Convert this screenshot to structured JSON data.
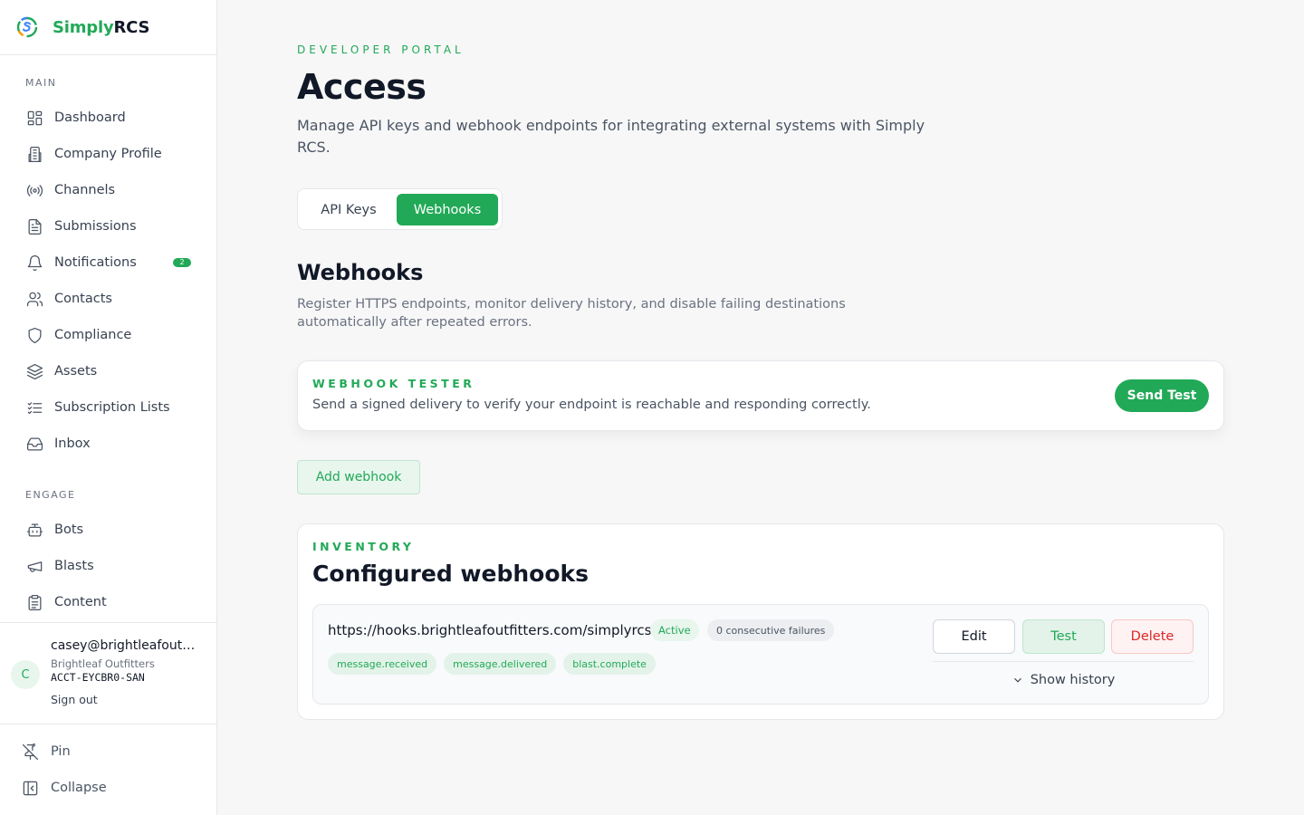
{
  "brand": {
    "name_part1": "Simply",
    "name_part2": "RCS"
  },
  "sidebar": {
    "sections": [
      {
        "label": "Main",
        "items": [
          {
            "label": "Dashboard",
            "icon": "dashboard-icon"
          },
          {
            "label": "Company Profile",
            "icon": "building-icon"
          },
          {
            "label": "Channels",
            "icon": "broadcast-icon"
          },
          {
            "label": "Submissions",
            "icon": "document-icon"
          },
          {
            "label": "Notifications",
            "icon": "bell-icon",
            "badge": "2"
          },
          {
            "label": "Contacts",
            "icon": "users-icon"
          },
          {
            "label": "Compliance",
            "icon": "shield-icon"
          },
          {
            "label": "Assets",
            "icon": "layers-icon"
          },
          {
            "label": "Subscription Lists",
            "icon": "list-check-icon"
          },
          {
            "label": "Inbox",
            "icon": "inbox-icon"
          }
        ]
      },
      {
        "label": "Engage",
        "items": [
          {
            "label": "Bots",
            "icon": "bot-icon"
          },
          {
            "label": "Blasts",
            "icon": "megaphone-icon"
          },
          {
            "label": "Content",
            "icon": "clipboard-icon"
          }
        ]
      }
    ],
    "user": {
      "initial": "C",
      "email": "casey@brightleafoutfitters.com",
      "org": "Brightleaf Outfitters",
      "account": "ACCT-EYCBR0-SAN",
      "signout": "Sign out"
    },
    "footer": {
      "pin": "Pin",
      "collapse": "Collapse"
    }
  },
  "main": {
    "eyebrow": "Developer Portal",
    "title": "Access",
    "description": "Manage API keys and webhook endpoints for integrating external systems with Simply RCS.",
    "tabs": [
      {
        "label": "API Keys",
        "active": false
      },
      {
        "label": "Webhooks",
        "active": true
      }
    ],
    "section_title": "Webhooks",
    "section_desc": "Register HTTPS endpoints, monitor delivery history, and disable failing destinations automatically after repeated errors.",
    "tester": {
      "eyebrow": "Webhook Tester",
      "desc": "Send a signed delivery to verify your endpoint is reachable and responding correctly.",
      "button": "Send Test"
    },
    "add_button": "Add webhook",
    "inventory": {
      "eyebrow": "Inventory",
      "title": "Configured webhooks",
      "webhooks": [
        {
          "url": "https://hooks.brightleafoutfitters.com/simplyrcs",
          "status": "Active",
          "failures": "0 consecutive failures",
          "events": [
            "message.received",
            "message.delivered",
            "blast.complete"
          ],
          "edit": "Edit",
          "test": "Test",
          "delete": "Delete",
          "history": "Show history"
        }
      ]
    }
  },
  "colors": {
    "accent": "#22a957",
    "danger": "#dc2626",
    "background": "#f7f7f8"
  }
}
